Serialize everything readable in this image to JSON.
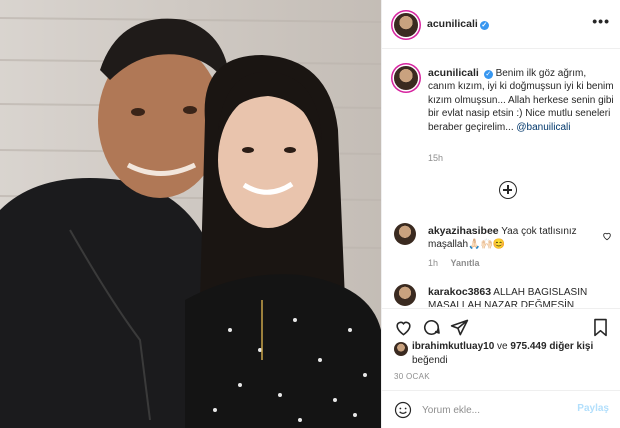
{
  "post": {
    "username": "acunilicali",
    "more_label": "•••"
  },
  "caption": {
    "username": "acunilicali",
    "text": "Benim ilk göz ağrım, canım kızım, iyi ki doğmuşsun iyi ki benim kızım olmuşsun... Allah herkese senin gibi bir evlat nasip etsin :) Nice mutlu seneleri beraber geçirelim...",
    "mention": "@banuilicali",
    "time": "15h"
  },
  "comments": [
    {
      "username": "akyazihasibee",
      "text": "Yaa çok tatlısınız maşallah🙏🏻🙌🏻😊",
      "time": "1h",
      "reply": "Yanıtla"
    },
    {
      "username": "karakoc3863",
      "text": "ALLAH BAGISLASIN MAŞALLAH NAZAR DEĞMESİN"
    }
  ],
  "likes": {
    "user": "ibrahimkutluay10",
    "mid": " ve ",
    "count": "975.449 diğer kişi",
    "suffix": "beğendi"
  },
  "date": "30 OCAK",
  "add_comment": {
    "placeholder": "Yorum ekle...",
    "share_label": "Paylaş"
  },
  "colors": {
    "verified": "#3897f0",
    "share": "#b2dffc",
    "meta": "#8e8e8e"
  },
  "icons": [
    "more-options-icon",
    "verified-badge-icon",
    "load-more-comments-icon",
    "heart-icon",
    "comment-icon",
    "share-icon",
    "save-icon",
    "emoji-icon"
  ]
}
